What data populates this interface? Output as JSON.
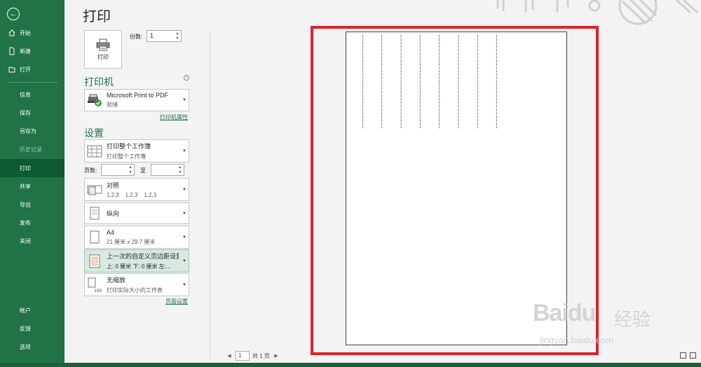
{
  "sidebar": {
    "items": [
      {
        "label": "开始",
        "icon": "home-icon"
      },
      {
        "label": "新建",
        "icon": "new-file-icon"
      },
      {
        "label": "打开",
        "icon": "open-folder-icon"
      },
      {
        "label": "信息"
      },
      {
        "label": "保存"
      },
      {
        "label": "另存为"
      },
      {
        "label": "历史记录"
      },
      {
        "label": "打印"
      },
      {
        "label": "共享"
      },
      {
        "label": "导出"
      },
      {
        "label": "发布"
      },
      {
        "label": "关闭"
      },
      {
        "label": "帐户"
      },
      {
        "label": "反馈"
      },
      {
        "label": "选项"
      }
    ]
  },
  "header": {
    "title": "打印"
  },
  "print": {
    "button_label": "打印",
    "copies_label": "份数:",
    "copies_value": "1"
  },
  "printer": {
    "section_title": "打印机",
    "name": "Microsoft Print to PDF",
    "status": "就绪",
    "properties_link": "打印机属性"
  },
  "settings": {
    "section_title": "设置",
    "scope": {
      "line1": "打印整个工作簿",
      "line2": "打印整个工作簿"
    },
    "pages_label": "页数:",
    "to_label": "至",
    "collate": {
      "line1": "对照",
      "line2": "1,2,3    1,2,3    1,2,3"
    },
    "orientation": {
      "line1": "纵向"
    },
    "paper": {
      "line1": "A4",
      "line2": "21 厘米 x 29.7 厘米"
    },
    "margins": {
      "line1": "上一次的自定义页边距设置",
      "line2": "上: 0 厘米 下: 0 厘米 左:..."
    },
    "scaling": {
      "line1": "无缩放",
      "line2": "打印实际大小的工作表"
    },
    "page_setup_link": "页面设置"
  },
  "preview": {
    "column_char": "1",
    "columns": 8,
    "rows": 27
  },
  "pager": {
    "current_page": "1",
    "total_text": "共 1 页"
  },
  "watermark": {
    "brand": "Baidu",
    "cn": "经验",
    "url": "jingyan.baidu.com"
  },
  "colors": {
    "sidebar": "#217346",
    "active": "#0e5a32",
    "highlight_frame": "#e0202e"
  }
}
